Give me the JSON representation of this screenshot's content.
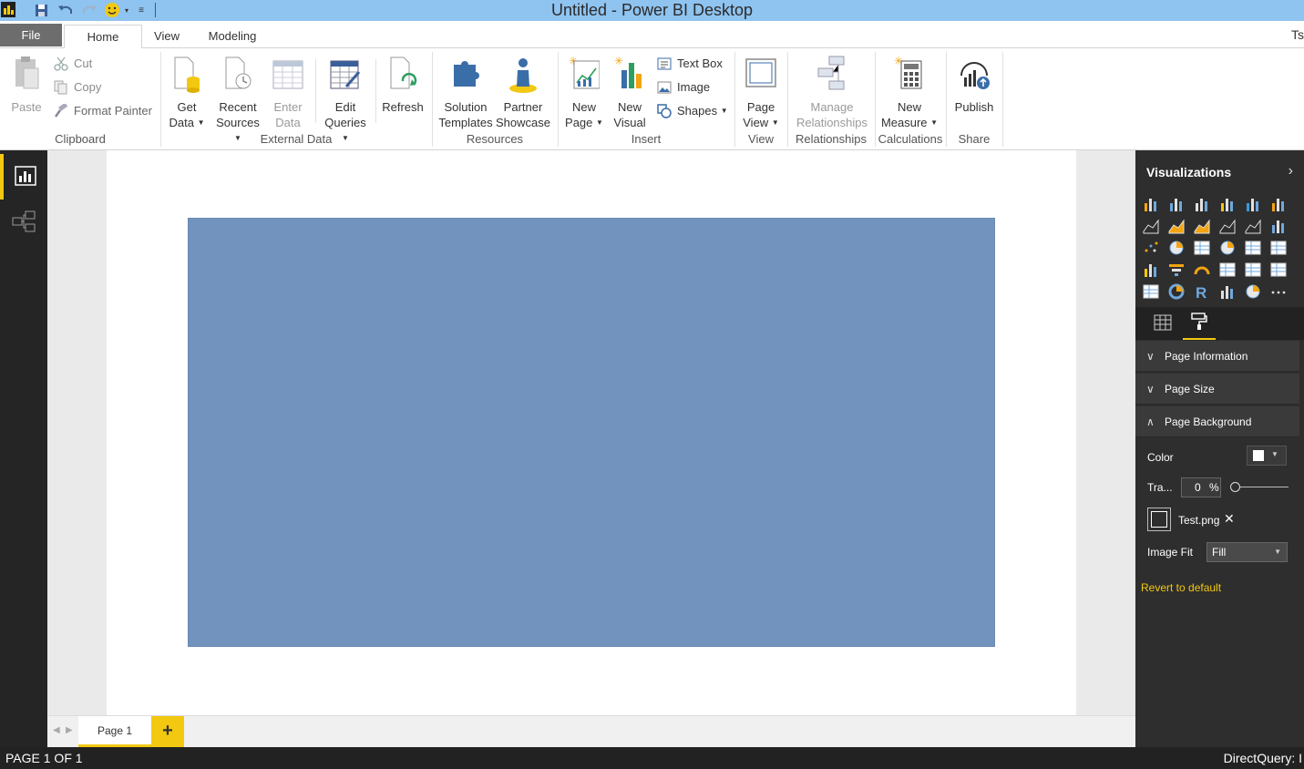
{
  "window": {
    "title": "Untitled - Power BI Desktop",
    "user_initials": "Ts"
  },
  "colors": {
    "accent": "#f2c811",
    "titlebar": "#8fc3f0",
    "canvas_bg_image": "#7193be",
    "pane_bg": "#2e2e2e"
  },
  "tabs": {
    "file": "File",
    "home": "Home",
    "view": "View",
    "modeling": "Modeling"
  },
  "ribbon": {
    "clipboard": {
      "paste": "Paste",
      "cut": "Cut",
      "copy": "Copy",
      "format_painter": "Format Painter",
      "label": "Clipboard"
    },
    "external_data": {
      "get_data_1": "Get",
      "get_data_2": "Data",
      "recent_sources_1": "Recent",
      "recent_sources_2": "Sources",
      "enter_data_1": "Enter",
      "enter_data_2": "Data",
      "edit_queries_1": "Edit",
      "edit_queries_2": "Queries",
      "refresh": "Refresh",
      "label": "External Data"
    },
    "resources": {
      "solution_templates_1": "Solution",
      "solution_templates_2": "Templates",
      "partner_showcase_1": "Partner",
      "partner_showcase_2": "Showcase",
      "label": "Resources"
    },
    "insert": {
      "new_page_1": "New",
      "new_page_2": "Page",
      "new_visual_1": "New",
      "new_visual_2": "Visual",
      "text_box": "Text Box",
      "image": "Image",
      "shapes": "Shapes",
      "label": "Insert"
    },
    "view": {
      "page_view_1": "Page",
      "page_view_2": "View",
      "label": "View"
    },
    "relationships": {
      "manage_1": "Manage",
      "manage_2": "Relationships",
      "label": "Relationships"
    },
    "calculations": {
      "new_measure_1": "New",
      "new_measure_2": "Measure",
      "label": "Calculations"
    },
    "share": {
      "publish": "Publish",
      "label": "Share"
    }
  },
  "page_tabs": {
    "page1": "Page 1",
    "add": "+"
  },
  "status": {
    "left": "PAGE 1 OF 1",
    "right": "DirectQuery: I"
  },
  "visualizations": {
    "header": "Visualizations",
    "icons": [
      "stacked-bar-chart-icon",
      "stacked-column-chart-icon",
      "clustered-bar-chart-icon",
      "clustered-column-chart-icon",
      "100-stacked-bar-chart-icon",
      "100-stacked-column-chart-icon",
      "line-chart-icon",
      "area-chart-icon",
      "stacked-area-chart-icon",
      "line-and-column-chart-icon",
      "line-and-clustered-column-chart-icon",
      "ribbon-chart-icon",
      "scatter-chart-icon",
      "pie-chart-icon",
      "treemap-icon",
      "map-icon",
      "table-icon",
      "matrix-icon",
      "filled-map-icon",
      "funnel-icon",
      "gauge-icon",
      "multi-row-card-icon",
      "card-icon",
      "kpi-icon",
      "slicer-icon",
      "donut-chart-icon",
      "r-visual-icon",
      "shape-map-icon",
      "globe-map-icon",
      "more-visuals-icon"
    ],
    "sections": {
      "page_information": "Page Information",
      "page_size": "Page Size",
      "page_background": "Page Background"
    },
    "props": {
      "color_label": "Color",
      "transparency_label": "Tra...",
      "transparency_value": "0",
      "transparency_unit": "%",
      "image_name": "Test.png",
      "image_fit_label": "Image Fit",
      "image_fit_value": "Fill",
      "revert": "Revert to default"
    }
  }
}
